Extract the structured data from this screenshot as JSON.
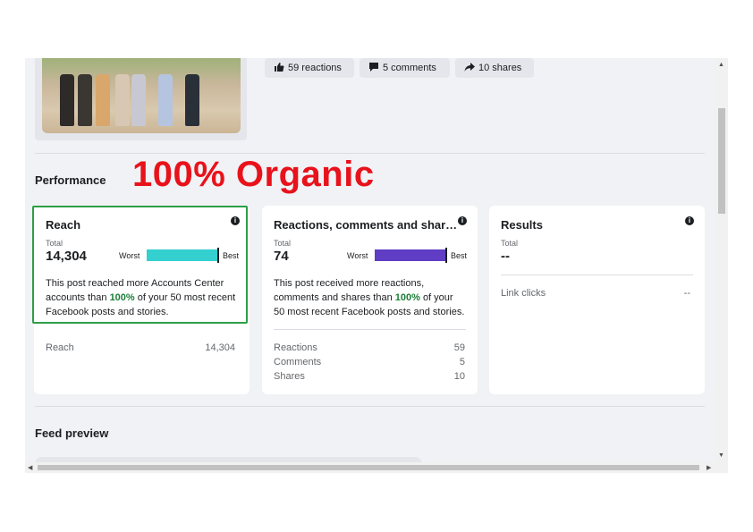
{
  "post": {
    "reactions_button": "59 reactions",
    "comments_button": "5 comments",
    "shares_button": "10 shares"
  },
  "performance": {
    "title": "Performance",
    "overlay_text": "100% Organic"
  },
  "cards": {
    "reach": {
      "title": "Reach",
      "total_label": "Total",
      "total_value": "14,304",
      "worst_label": "Worst",
      "best_label": "Best",
      "bar_color": "#34cfcf",
      "bar_fraction": 1.0,
      "desc_prefix": "This post reached more Accounts Center accounts than ",
      "desc_highlight": "100%",
      "desc_suffix": " of your 50 most recent Facebook posts and stories.",
      "rows": [
        {
          "label": "Reach",
          "value": "14,304"
        }
      ]
    },
    "engagement": {
      "title": "Reactions, comments and shar…",
      "total_label": "Total",
      "total_value": "74",
      "worst_label": "Worst",
      "best_label": "Best",
      "bar_color": "#5f3dc4",
      "bar_fraction": 1.0,
      "desc_prefix": "This post received more reactions, comments and shares than ",
      "desc_highlight": "100%",
      "desc_suffix": " of your 50 most recent Facebook posts and stories.",
      "rows": [
        {
          "label": "Reactions",
          "value": "59"
        },
        {
          "label": "Comments",
          "value": "5"
        },
        {
          "label": "Shares",
          "value": "10"
        }
      ]
    },
    "results": {
      "title": "Results",
      "total_label": "Total",
      "total_value": "--",
      "rows": [
        {
          "label": "Link clicks",
          "value": "--"
        }
      ]
    }
  },
  "feed": {
    "title": "Feed preview"
  },
  "colors": {
    "organic_red": "#e8121b",
    "highlight_green": "#2e9e47",
    "percent_green": "#1a7f37"
  },
  "icons": [
    "thumbs-up-icon",
    "comment-icon",
    "share-icon",
    "info-icon"
  ]
}
